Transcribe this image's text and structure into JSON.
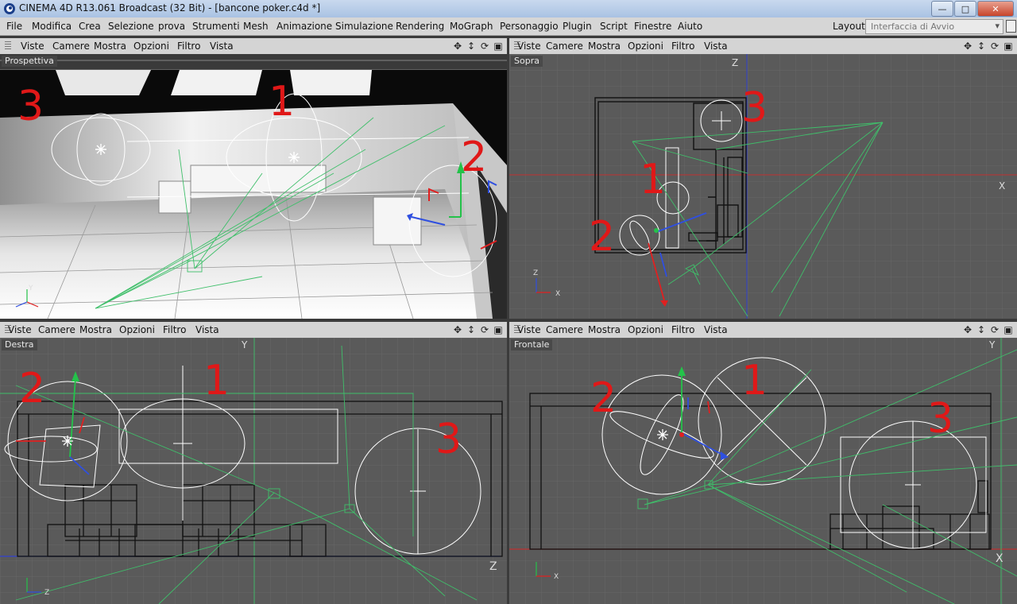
{
  "window": {
    "title": "CINEMA 4D R13.061 Broadcast (32 Bit) - [bancone poker.c4d *]",
    "buttons": [
      "minimize",
      "maximize",
      "close"
    ]
  },
  "menubar": {
    "items": [
      "File",
      "Modifica",
      "Crea",
      "Selezione",
      "prova",
      "Strumenti",
      "Mesh",
      "Animazione",
      "Simulazione",
      "Rendering",
      "MoGraph",
      "Personaggio",
      "Plugin",
      "Script",
      "Finestre",
      "Aiuto"
    ],
    "layout_label": "Layout:",
    "layout_value": "Interfaccia di Avvio"
  },
  "viewport_menu": [
    "Viste",
    "Camere",
    "Mostra",
    "Opzioni",
    "Filtro",
    "Vista"
  ],
  "viewport_controls": [
    "move-icon",
    "zoom-icon",
    "rotate-icon",
    "toggle-view-icon"
  ],
  "viewports": [
    {
      "id": "perspective",
      "label": "Prospettiva",
      "numbers": [
        "3",
        "1",
        "2"
      ]
    },
    {
      "id": "top",
      "label": "Sopra",
      "numbers": [
        "3",
        "1",
        "2"
      ],
      "axis_labels": [
        "Z",
        "X"
      ]
    },
    {
      "id": "right",
      "label": "Destra",
      "numbers": [
        "2",
        "1",
        "3"
      ],
      "axis_labels": [
        "Y",
        "Z"
      ]
    },
    {
      "id": "front",
      "label": "Frontale",
      "numbers": [
        "2",
        "1",
        "3"
      ],
      "axis_labels": [
        "Y",
        "X"
      ]
    }
  ],
  "colors": {
    "annotation": "#e01818",
    "viewport_bg": "#5a5a5a",
    "grid": "#646464",
    "light_line": "#3fbf6a",
    "wire": "#111111"
  }
}
